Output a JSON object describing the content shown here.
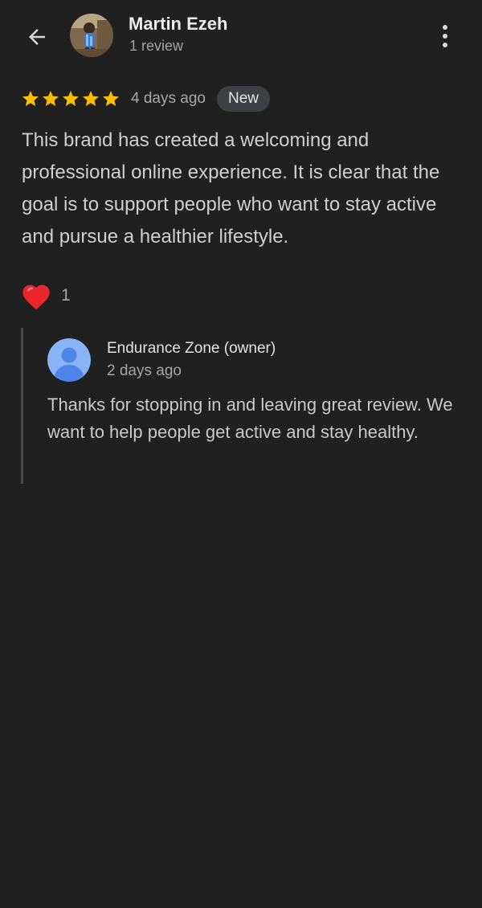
{
  "header": {
    "back_icon": "arrow-left-icon",
    "reviewer_name": "Martin Ezeh",
    "reviewer_meta": "1 review",
    "more_icon": "more-vertical-icon"
  },
  "review": {
    "rating": 5,
    "rating_max": 5,
    "time_ago": "4 days ago",
    "badge": "New",
    "text": "This brand has created a welcoming and professional online experience. It is clear that the goal is to support people who want to stay active and pursue a healthier lifestyle.",
    "like_icon": "heart-icon",
    "like_count": "1"
  },
  "owner_reply": {
    "name": "Endurance Zone (owner)",
    "time_ago": "2 days ago",
    "text": "Thanks for stopping in and leaving great review. We want to help people get active and stay healthy."
  },
  "colors": {
    "background": "#202020",
    "star": "#fbbc04",
    "heart": "#e8262b",
    "badge_bg": "#3d3f43",
    "owner_avatar": "#8ab4f8"
  }
}
